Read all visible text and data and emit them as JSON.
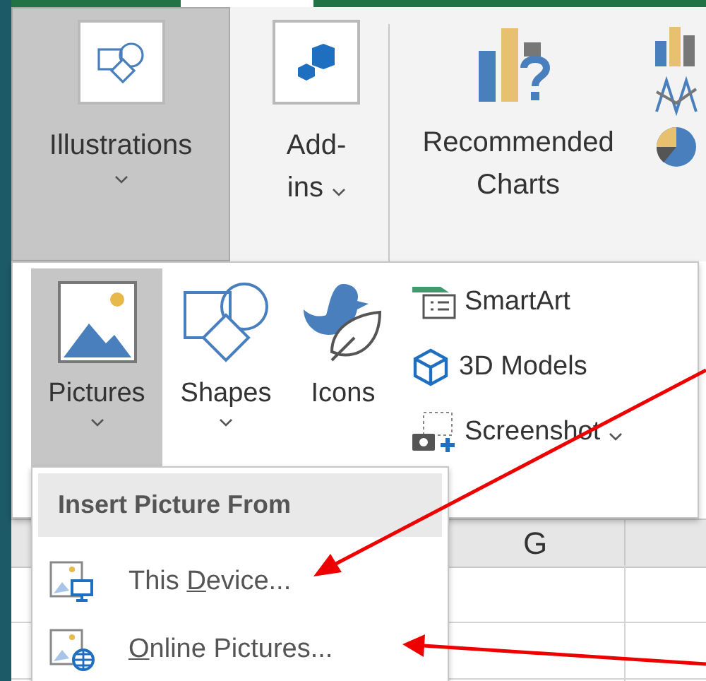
{
  "ribbon": {
    "illustrations": {
      "label": "Illustrations",
      "pressed": true
    },
    "addins": {
      "lines": [
        "Add-",
        "ins"
      ]
    },
    "recommended_charts": {
      "lines": [
        "Recommended",
        "Charts"
      ]
    }
  },
  "gallery": {
    "large_buttons": [
      {
        "kind": "pictures",
        "label": "Pictures",
        "selected": true,
        "dropdown": true
      },
      {
        "kind": "shapes",
        "label": "Shapes",
        "selected": false,
        "dropdown": true
      },
      {
        "kind": "icons",
        "label": "Icons",
        "selected": false,
        "dropdown": false
      }
    ],
    "small_buttons": [
      {
        "kind": "smartart",
        "label": "SmartArt",
        "dropdown": false
      },
      {
        "kind": "models",
        "label": "3D Models",
        "dropdown": false
      },
      {
        "kind": "screenshot",
        "label": "Screenshot",
        "dropdown": true
      }
    ]
  },
  "sheet": {
    "columns": [
      "G"
    ]
  },
  "menu": {
    "header": "Insert Picture From",
    "items": [
      {
        "kind": "device",
        "before": "This ",
        "key": "D",
        "after": "evice..."
      },
      {
        "kind": "online",
        "key": "O",
        "after": "nline Pictures..."
      }
    ]
  }
}
